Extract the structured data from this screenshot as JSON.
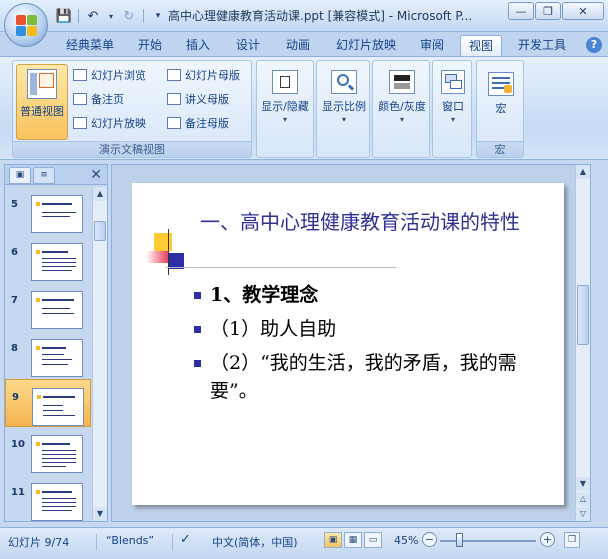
{
  "window": {
    "title": "高中心理健康教育活动课.ppt [兼容模式] - Microsoft P..."
  },
  "quick_access": {
    "save": "save-icon",
    "undo": "undo-icon",
    "redo": "redo-icon",
    "customize": "dropdown-icon"
  },
  "tabs": [
    "经典菜单",
    "开始",
    "插入",
    "设计",
    "动画",
    "幻灯片放映",
    "审阅",
    "视图",
    "开发工具"
  ],
  "active_tab": "视图",
  "ribbon": {
    "presentation_views": {
      "label": "演示文稿视图",
      "normal": "普通视图",
      "slide_sorter": "幻灯片浏览",
      "notes_page": "备注页",
      "slide_show": "幻灯片放映",
      "slide_master": "幻灯片母版",
      "handout_master": "讲义母版",
      "notes_master": "备注母版"
    },
    "show_hide": "显示/隐藏",
    "zoom": "显示比例",
    "color": "颜色/灰度",
    "window": "窗口",
    "macros": {
      "button": "宏",
      "label": "宏"
    }
  },
  "thumbnails": [
    {
      "num": "5"
    },
    {
      "num": "6"
    },
    {
      "num": "7"
    },
    {
      "num": "8"
    },
    {
      "num": "9"
    },
    {
      "num": "10"
    },
    {
      "num": "11"
    }
  ],
  "selected_thumbnail": "9",
  "slide": {
    "title": "一、高中心理健康教育活动课的特性",
    "bullets": [
      "1、教学理念",
      "（1）助人自助",
      "（2）“我的生活，我的矛盾，我的需要”。"
    ]
  },
  "status": {
    "slide_info": "幻灯片 9/74",
    "theme": "“Blends”",
    "language": "中文(简体，中国)",
    "zoom": "45%"
  },
  "colors": {
    "title_color": "#2e3093",
    "accent_active": "#f7c35c",
    "ribbon_text": "#15428b"
  }
}
